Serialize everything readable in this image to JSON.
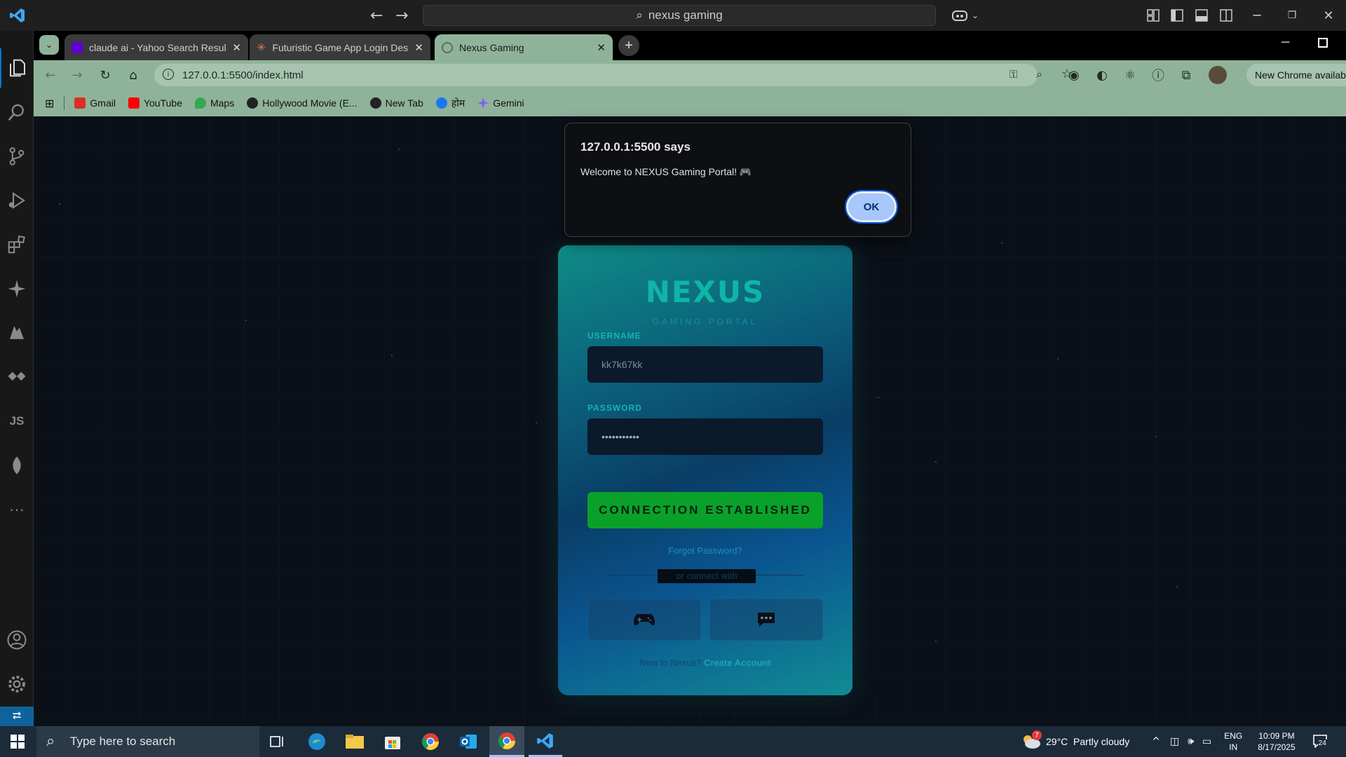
{
  "vscode": {
    "command_center": "nexus gaming"
  },
  "chrome": {
    "tabs": [
      {
        "title": "claude ai - Yahoo Search Results",
        "icon": "yahoo-icon",
        "active": false
      },
      {
        "title": "Futuristic Game App Login Design",
        "icon": "claude-icon",
        "active": false
      },
      {
        "title": "Nexus Gaming",
        "icon": "globe-icon",
        "active": true
      }
    ],
    "new_tab_symbol": "+",
    "url": "127.0.0.1:5500/index.html",
    "new_chrome_banner": "New Chrome available",
    "bookmarks": [
      {
        "label": "Gmail",
        "color": "#d93025"
      },
      {
        "label": "YouTube",
        "color": "#ff0000"
      },
      {
        "label": "Maps",
        "color": "#34a853"
      },
      {
        "label": "Hollywood Movie (E...",
        "color": "#222222"
      },
      {
        "label": "New Tab",
        "color": "#222222"
      },
      {
        "label": "होम",
        "color": "#1877f2"
      },
      {
        "label": "Gemini",
        "color": "#7b61ff"
      }
    ]
  },
  "dialog": {
    "title": "127.0.0.1:5500 says",
    "message": "Welcome to NEXUS Gaming Portal! 🎮",
    "ok_label": "OK"
  },
  "login": {
    "logo": "NEXUS",
    "subtitle": "GAMING PORTAL",
    "username_label": "USERNAME",
    "username_value": "kk7k67kk",
    "password_label": "PASSWORD",
    "password_value": "•••••••••••",
    "submit_label": "CONNECTION ESTABLISHED",
    "forgot_label": "Forgot Password?",
    "divider_text": "or connect with",
    "signup_prefix": "New to Nexus?",
    "signup_link": "Create Account"
  },
  "taskbar": {
    "search_placeholder": "Type here to search",
    "weather": "29°C  Partly cloudy",
    "weather_badge": "7",
    "lang_top": "ENG",
    "lang_bottom": "IN",
    "time": "10:09 PM",
    "date": "8/17/2025",
    "notifications": "24"
  },
  "colors": {
    "accent_teal": "#0fb5a5",
    "button_green": "#0aa12a",
    "chrome_toolbar": "#8fb39a"
  }
}
